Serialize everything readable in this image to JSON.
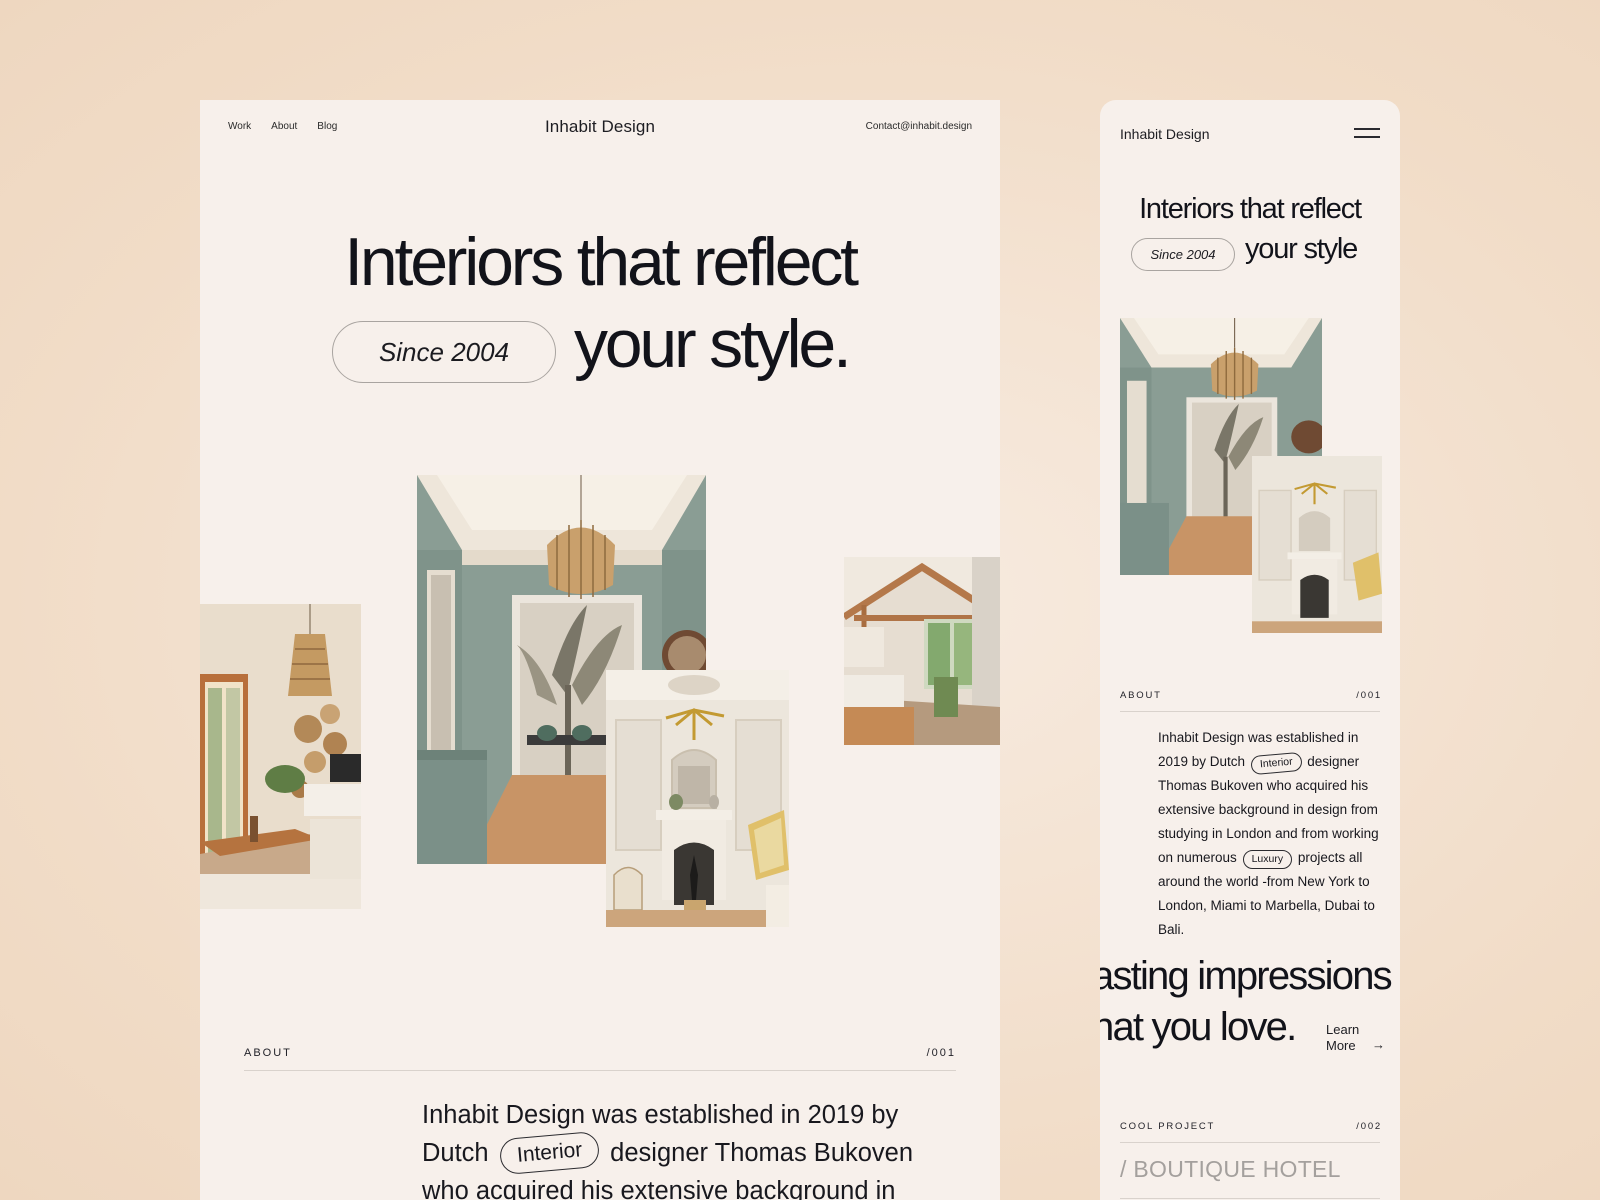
{
  "desktop": {
    "nav": [
      "Work",
      "About",
      "Blog"
    ],
    "brand": "Inhabit Design",
    "contact": "Contact@inhabit.design",
    "hero_line1": "Interiors that reflect",
    "hero_pill": "Since 2004",
    "hero_line2": "your style.",
    "about_label": "ABOUT",
    "about_number": "/001",
    "about_text_1": "Inhabit Design was established in 2019 by Dutch",
    "about_tag": "Interior",
    "about_text_2": "designer Thomas Bukoven who acquired his extensive background in"
  },
  "mobile": {
    "brand": "Inhabit Design",
    "menu_icon": "hamburger-icon",
    "hero_line1": "Interiors that reflect",
    "hero_pill": "Since 2004",
    "hero_line2": "your style",
    "about_label": "ABOUT",
    "about_number": "/001",
    "about_text_1": "Inhabit Design was established in 2019 by Dutch",
    "about_tag_1": "Interior",
    "about_text_2": "designer Thomas Bukoven  who acquired his extensive background in design from studying in London and from working on numerous",
    "about_tag_2": "Luxury",
    "about_text_3": "projects all around the world -from New York to London, Miami to Marbella, Dubai to Bali.",
    "marquee_line1": "asting impressions",
    "marquee_line2": "hat you love.",
    "learn_more_1": "Learn",
    "learn_more_2": "More",
    "learn_arrow": "→",
    "project_label": "COOL PROJECT",
    "project_number": "/002",
    "project_title": "/ BOUTIQUE HOTEL"
  },
  "colors": {
    "background": "#f1dcc7",
    "card": "#f7f0eb",
    "text": "#12131a",
    "muted": "#a4a09d",
    "sage_wall": "#8a9d94"
  }
}
